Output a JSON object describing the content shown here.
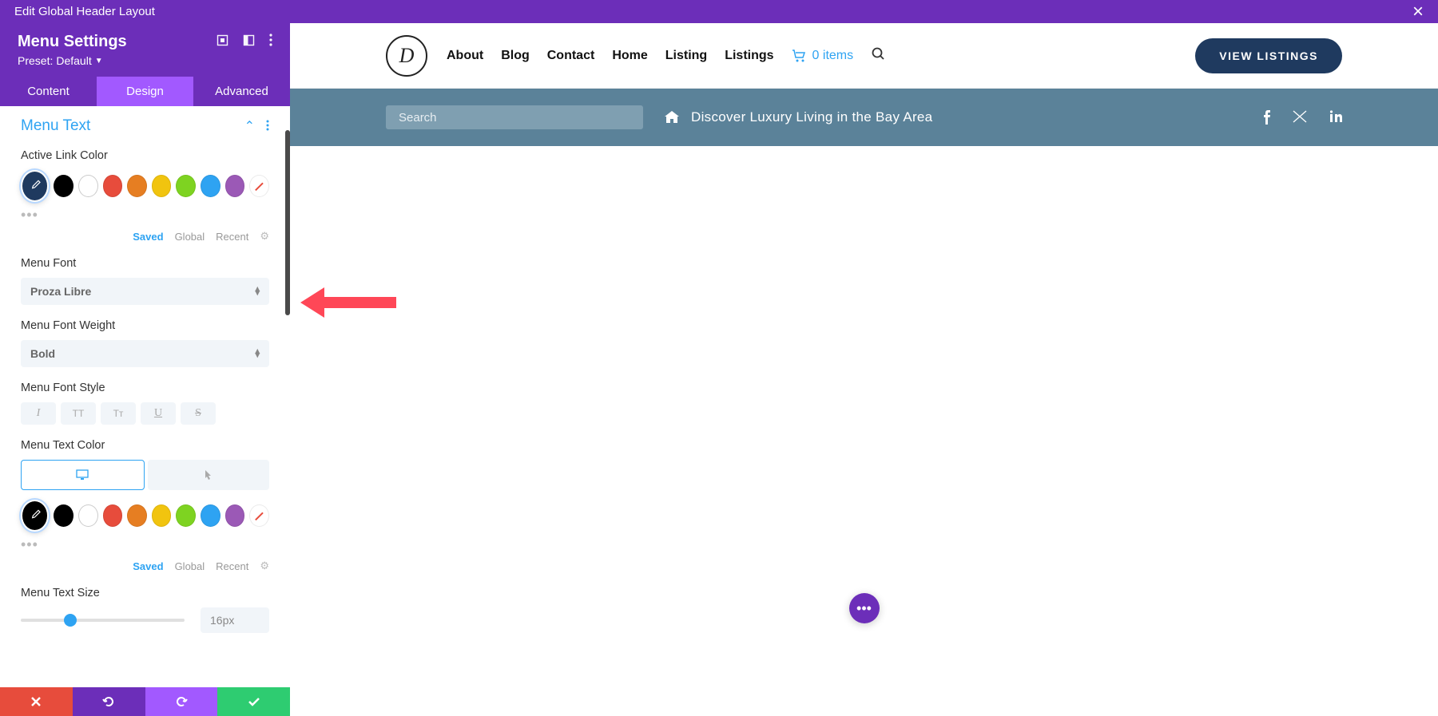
{
  "topbar": {
    "title": "Edit Global Header Layout",
    "close": "×"
  },
  "sidebar": {
    "title": "Menu Settings",
    "preset_label": "Preset:",
    "preset_value": "Default",
    "tabs": {
      "content": "Content",
      "design": "Design",
      "advanced": "Advanced"
    },
    "section": {
      "title": "Menu Text",
      "active_link_color": "Active Link Color",
      "menu_font": "Menu Font",
      "menu_font_val": "Proza Libre",
      "menu_font_weight": "Menu Font Weight",
      "menu_font_weight_val": "Bold",
      "menu_font_style": "Menu Font Style",
      "menu_text_color": "Menu Text Color",
      "menu_text_size": "Menu Text Size",
      "menu_text_size_val": "16px",
      "color_tabs": {
        "saved": "Saved",
        "global": "Global",
        "recent": "Recent"
      },
      "style_btns": {
        "italic": "I",
        "upper": "TT",
        "small": "Tᴛ",
        "under": "U",
        "strike": "S"
      },
      "swatches": [
        "#000000",
        "#ffffff",
        "#e74c3c",
        "#e67e22",
        "#f1c40f",
        "#7ed321",
        "#2ea3f2",
        "#9b59b6"
      ]
    }
  },
  "footer_icons": {
    "cancel": "✕",
    "undo": "↺",
    "redo": "↻",
    "save": "✓"
  },
  "preview": {
    "nav": [
      "About",
      "Blog",
      "Contact",
      "Home",
      "Listing",
      "Listings"
    ],
    "cart": "0 items",
    "cta": "VIEW LISTINGS",
    "search_ph": "Search",
    "tagline": "Discover Luxury Living in the Bay Area"
  }
}
